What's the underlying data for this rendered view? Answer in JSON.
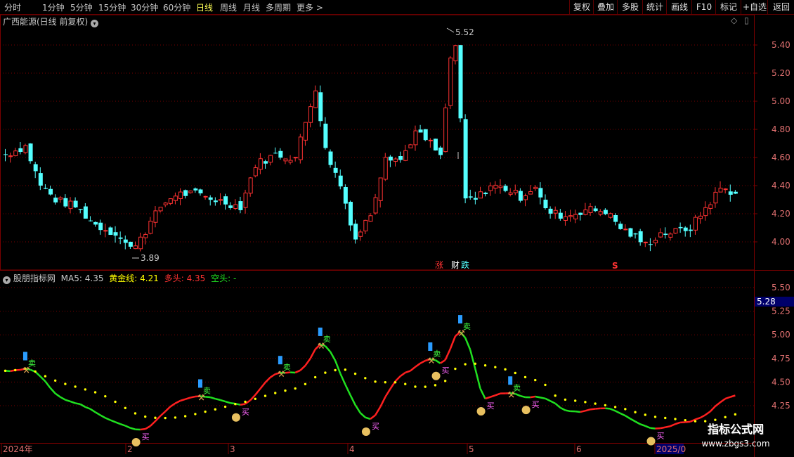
{
  "toolbar": {
    "periods": [
      "分时",
      "1分钟",
      "5分钟",
      "15分钟",
      "30分钟",
      "60分钟",
      "日线",
      "周线",
      "月线",
      "多周期",
      "更多 >"
    ],
    "active_period": "日线",
    "right_buttons": [
      "复权",
      "叠加",
      "多股",
      "统计",
      "画线",
      "F10",
      "标记",
      "+自选",
      "返回"
    ]
  },
  "main_panel": {
    "title": "广西能源(日线 前复权)",
    "chevron_icon": "chevron-down-icon",
    "price_axis": [
      "5.40",
      "5.20",
      "5.00",
      "4.80",
      "4.60",
      "4.40",
      "4.20",
      "4.00"
    ],
    "high_label": "5.52",
    "low_label": "3.89",
    "markers": [
      "涨",
      "财",
      "跌"
    ],
    "special_icon": "S"
  },
  "indicator_panel": {
    "name": "股朋指标网",
    "ma5_label": "MA5:",
    "ma5_value": "4.35",
    "gold_label": "黄金线:",
    "gold_value": "4.21",
    "long_label": "多头:",
    "long_value": "4.35",
    "short_label": "空头:",
    "short_value": "-",
    "axis": [
      "5.50",
      "5.25",
      "5.00",
      "4.75",
      "4.50",
      "4.25"
    ],
    "current_value": "5.28",
    "buy_label": "买",
    "sell_label": "卖"
  },
  "time_axis": {
    "labels": [
      "2024年",
      "2",
      "3",
      "4",
      "5",
      "6",
      "2025/0"
    ]
  },
  "watermark": {
    "title": "指标公式网",
    "url": "www.zbgs3.com"
  },
  "colors": {
    "up": "#ff3232",
    "down": "#54ffff",
    "grid": "#7a0000",
    "ma_long": "#ff2020",
    "ma_short": "#20e020",
    "gold": "#ffff00"
  }
}
